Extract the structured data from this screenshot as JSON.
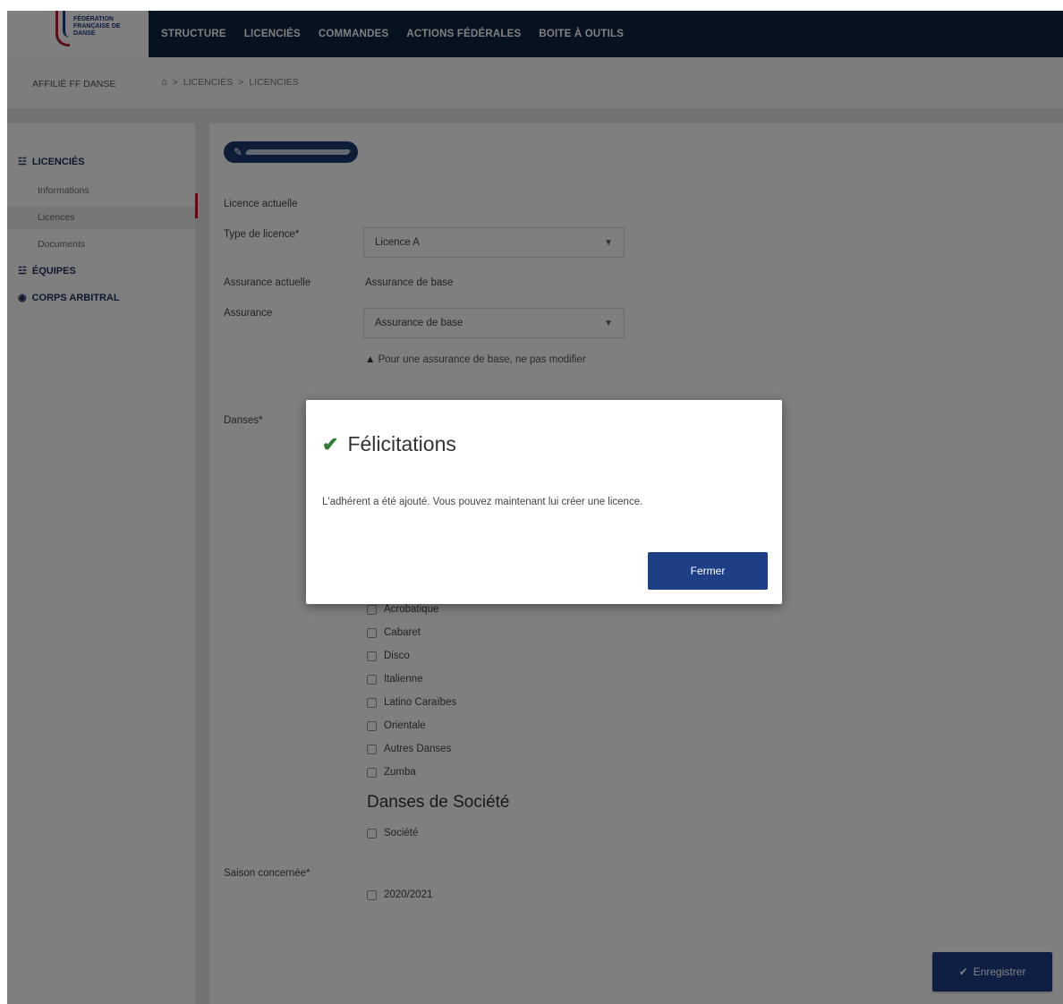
{
  "brand": {
    "logo_text": "FÉDÉRATION FRANÇAISE DE DANSE"
  },
  "nav": {
    "items": [
      "STRUCTURE",
      "LICENCIÉS",
      "COMMANDES",
      "ACTIONS FÉDÉRALES",
      "BOITE À OUTILS"
    ]
  },
  "breadcrumb": {
    "affiliation": "AFFILIÉ FF DANSE",
    "items": [
      "LICENCIÉS",
      "LICENCIES"
    ],
    "separator": ">"
  },
  "sidebar": {
    "sections": [
      {
        "label": "LICENCIÉS",
        "icon": "users-icon"
      },
      {
        "label": "ÉQUIPES",
        "icon": "users-icon"
      },
      {
        "label": "CORPS ARBITRAL",
        "icon": "eye-icon"
      }
    ],
    "sub_items": [
      "Informations",
      "Licences",
      "Documents"
    ],
    "active_sub": "Licences"
  },
  "form": {
    "current_license_label": "Licence actuelle",
    "license_type_label": "Type de licence*",
    "license_type_value": "Licence A",
    "current_insurance_label": "Assurance actuelle",
    "current_insurance_value": "Assurance de base",
    "insurance_label": "Assurance",
    "insurance_value": "Assurance de base",
    "insurance_warning": "Pour une assurance de base, ne pas modifier",
    "dances_label": "Danses*",
    "dance_options": [
      "Acrobatique",
      "Cabaret",
      "Disco",
      "Italienne",
      "Latino Caraïbes",
      "Orientale",
      "Autres Danses",
      "Zumba"
    ],
    "social_heading": "Danses de Société",
    "social_options": [
      "Société"
    ],
    "season_label": "Saison concernée*",
    "season_value": "2020/2021",
    "save_label": "Enregistrer"
  },
  "modal": {
    "title": "Félicitations",
    "body": "L'adhérent a été ajouté. Vous pouvez maintenant lui créer une licence.",
    "close_label": "Fermer"
  },
  "colors": {
    "nav_bg": "#0c2440",
    "primary_button": "#1c3f86",
    "accent_red": "#c8102e",
    "success_green": "#2e7d32"
  }
}
